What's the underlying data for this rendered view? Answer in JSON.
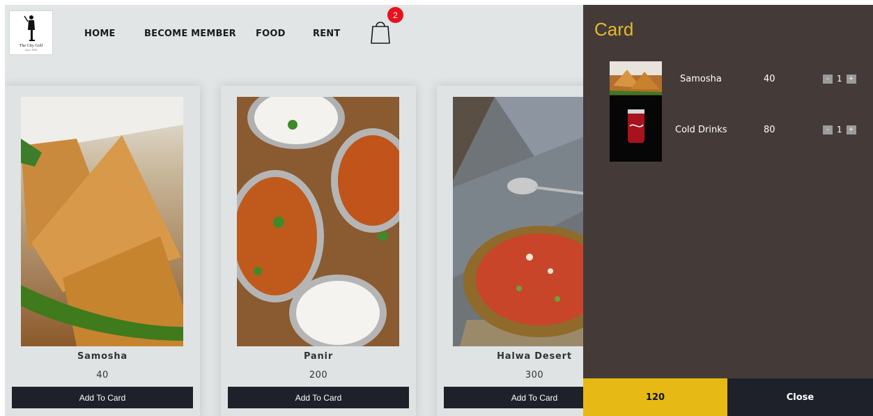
{
  "brand": {
    "logo_text": "The City Golf",
    "logo_sub": "since 1936"
  },
  "nav": {
    "home": "HOME",
    "member": "BECOME MEMBER",
    "food": "FOOD",
    "rent": "RENT"
  },
  "cart_icon": {
    "icon": "shopping-bag-icon",
    "count": "2"
  },
  "products": [
    {
      "name": "Samosha",
      "price": "40",
      "button": "Add To Card",
      "image": "samosa-photo"
    },
    {
      "name": "Panir",
      "price": "200",
      "button": "Add To Card",
      "image": "paneer-curry-photo"
    },
    {
      "name": "Halwa Desert",
      "price": "300",
      "button": "Add To Card",
      "image": "halwa-photo"
    }
  ],
  "cart": {
    "title": "Card",
    "items": [
      {
        "name": "Samosha",
        "price": "40",
        "qty": "1",
        "minus": "-",
        "plus": "+"
      },
      {
        "name": "Cold Drinks",
        "price": "80",
        "qty": "1",
        "minus": "-",
        "plus": "+"
      }
    ],
    "total": "120",
    "close_label": "Close"
  },
  "colors": {
    "accent": "#e6b914",
    "panel_bg": "#443b39",
    "button_dark": "#1e212a",
    "badge": "#e8111e"
  }
}
